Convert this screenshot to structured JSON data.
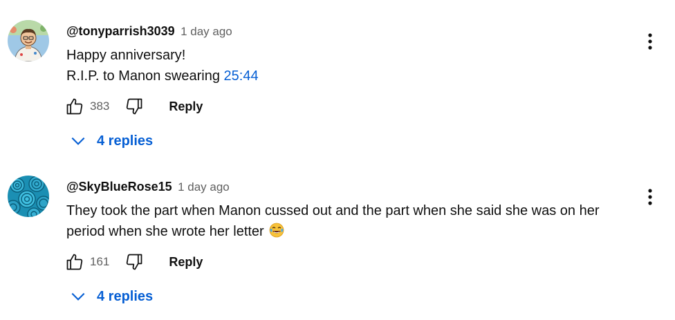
{
  "comments": [
    {
      "author": "@tonyparrish3039",
      "time": "1 day ago",
      "lines": [
        "Happy anniversary!",
        "R.I.P. to Manon swearing "
      ],
      "timestamp": "25:44",
      "likes": "383",
      "reply_label": "Reply",
      "replies_label": "4 replies",
      "avatar_icon": "cartoon-person-avatar"
    },
    {
      "author": "@SkyBlueRose15",
      "time": "1 day ago",
      "lines": [
        "They took the part when Manon cussed out and the part when she said she was on her",
        "period when she wrote her letter "
      ],
      "emoji": "face-with-tears-of-joy",
      "likes": "161",
      "reply_label": "Reply",
      "replies_label": "4 replies",
      "avatar_icon": "blue-roses-avatar"
    }
  ],
  "colors": {
    "link": "#065fd4",
    "secondary_text": "#606060",
    "primary_text": "#0f0f0f"
  }
}
